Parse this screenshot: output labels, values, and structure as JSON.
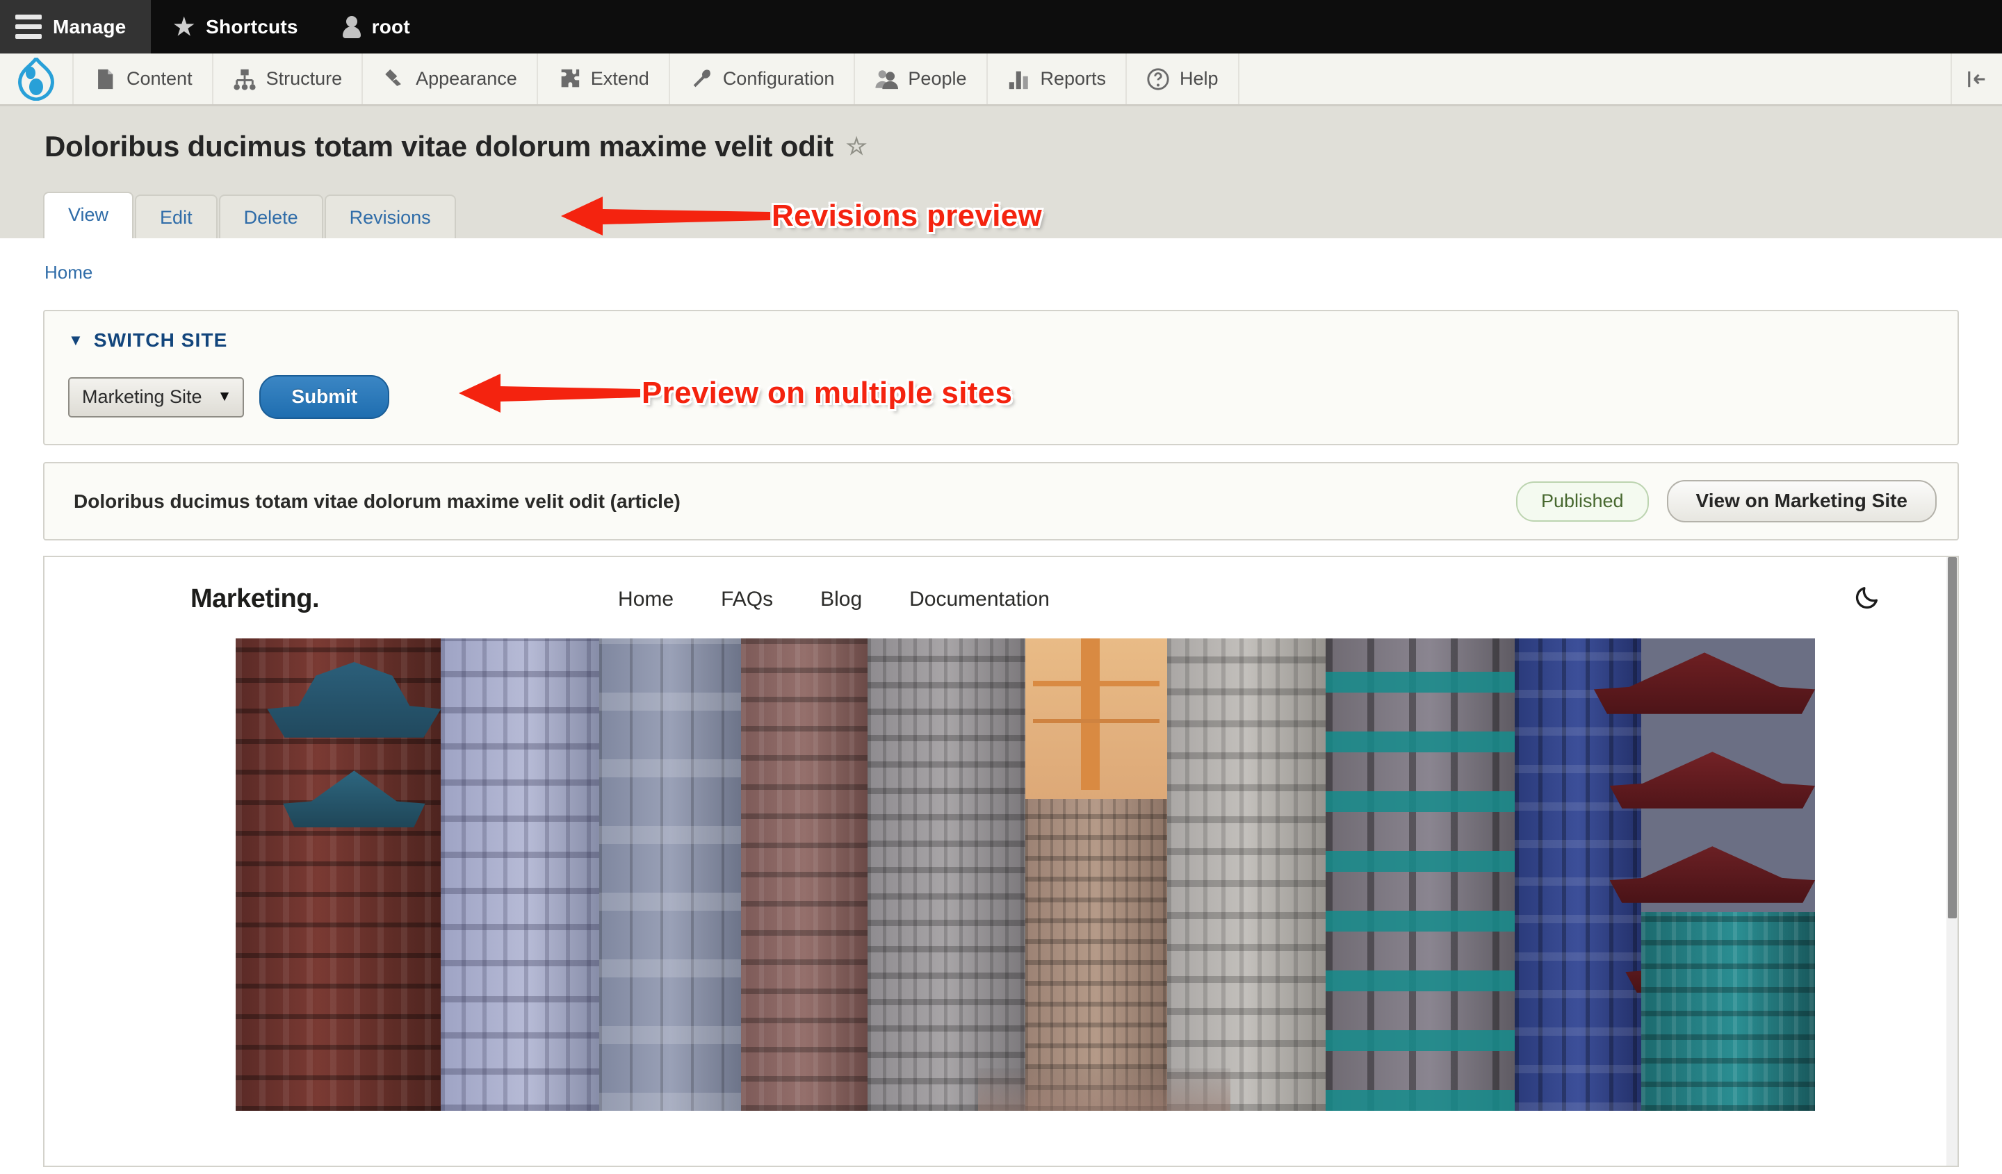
{
  "toolbar": {
    "manage_label": "Manage",
    "manage_icon": "hamburger-icon",
    "shortcuts_label": "Shortcuts",
    "shortcuts_icon": "star-icon",
    "user_label": "root",
    "user_icon": "person-icon"
  },
  "admin_menu": {
    "logo_icon": "drupal-drop-icon",
    "tray_handle_icon": "collapse-tray-icon",
    "items": [
      {
        "label": "Content",
        "icon": "page-icon"
      },
      {
        "label": "Structure",
        "icon": "sitemap-icon"
      },
      {
        "label": "Appearance",
        "icon": "paintbrush-icon"
      },
      {
        "label": "Extend",
        "icon": "puzzle-piece-icon"
      },
      {
        "label": "Configuration",
        "icon": "wrench-icon"
      },
      {
        "label": "People",
        "icon": "people-icon"
      },
      {
        "label": "Reports",
        "icon": "bar-chart-icon"
      },
      {
        "label": "Help",
        "icon": "question-mark-icon"
      }
    ]
  },
  "page": {
    "title": "Doloribus ducimus totam vitae dolorum maxime velit odit",
    "favorite_icon": "star-outline-icon",
    "breadcrumb": "Home",
    "tabs": [
      {
        "label": "View",
        "active": true
      },
      {
        "label": "Edit",
        "active": false
      },
      {
        "label": "Delete",
        "active": false
      },
      {
        "label": "Revisions",
        "active": false
      }
    ]
  },
  "annotations": [
    {
      "text": "Revisions preview",
      "arrow": "left-arrow-icon",
      "color": "#f4230f"
    },
    {
      "text": "Preview on multiple sites",
      "arrow": "left-arrow-icon",
      "color": "#f4230f"
    }
  ],
  "switch_site": {
    "legend": "SWITCH SITE",
    "caret": "▼",
    "select_value": "Marketing Site",
    "select_caret": "▼",
    "submit_label": "Submit",
    "submit_color": "#1f6eb0"
  },
  "node_bar": {
    "label": "Doloribus ducimus totam vitae dolorum maxime velit odit (article)",
    "status_badge": "Published",
    "status_color": "#47682f",
    "view_button": "View on Marketing Site"
  },
  "preview_site": {
    "logo": "Marketing.",
    "nav": [
      "Home",
      "FAQs",
      "Blog",
      "Documentation"
    ],
    "dark_mode_icon": "crescent-moon-icon",
    "hero_alt": "city-buildings-photo",
    "scrollbar": "vertical-scrollbar"
  }
}
